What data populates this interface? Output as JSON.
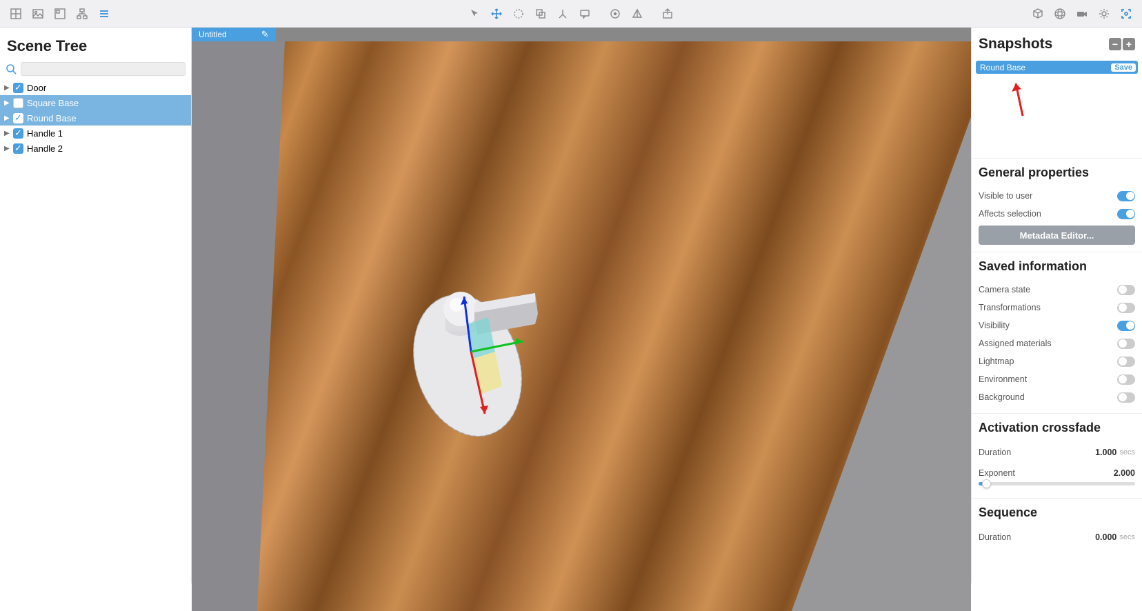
{
  "toolbar": {
    "left_icons": [
      "grid-4-icon",
      "image-icon",
      "grid-2-icon",
      "hierarchy-icon",
      "list-icon"
    ],
    "center_icons": [
      "cursor-icon",
      "move-icon",
      "rotate-icon",
      "clone-icon",
      "axis-icon",
      "comment-icon"
    ],
    "center2_icons": [
      "target-icon",
      "pyramid-icon"
    ],
    "export_icon": "export-icon",
    "right_icons": [
      "cube-icon",
      "sphere-icon",
      "camera-icon",
      "gear-icon",
      "focus-icon"
    ]
  },
  "left_panel": {
    "title": "Scene Tree",
    "search_placeholder": "",
    "items": [
      {
        "label": "Door",
        "checked": true,
        "selected": false
      },
      {
        "label": "Square Base",
        "checked": false,
        "selected": true
      },
      {
        "label": "Round Base",
        "checked": true,
        "selected": true
      },
      {
        "label": "Handle 1",
        "checked": true,
        "selected": false
      },
      {
        "label": "Handle 2",
        "checked": true,
        "selected": false
      }
    ]
  },
  "viewport": {
    "tab_label": "Untitled"
  },
  "right_panel": {
    "snapshots_title": "Snapshots",
    "snapshot_name": "Round Base",
    "save_label": "Save",
    "general_title": "General properties",
    "general": [
      {
        "label": "Visible to user",
        "on": true
      },
      {
        "label": "Affects selection",
        "on": true
      }
    ],
    "metadata_btn": "Metadata Editor...",
    "saved_title": "Saved information",
    "saved": [
      {
        "label": "Camera state",
        "on": false
      },
      {
        "label": "Transformations",
        "on": false
      },
      {
        "label": "Visibility",
        "on": true
      },
      {
        "label": "Assigned materials",
        "on": false
      },
      {
        "label": "Lightmap",
        "on": false
      },
      {
        "label": "Environment",
        "on": false
      },
      {
        "label": "Background",
        "on": false
      }
    ],
    "crossfade_title": "Activation crossfade",
    "duration_label": "Duration",
    "duration_value": "1.000",
    "duration_unit": "secs",
    "exponent_label": "Exponent",
    "exponent_value": "2.000",
    "sequence_title": "Sequence",
    "seq_duration_label": "Duration",
    "seq_duration_value": "0.000",
    "seq_duration_unit": "secs"
  }
}
